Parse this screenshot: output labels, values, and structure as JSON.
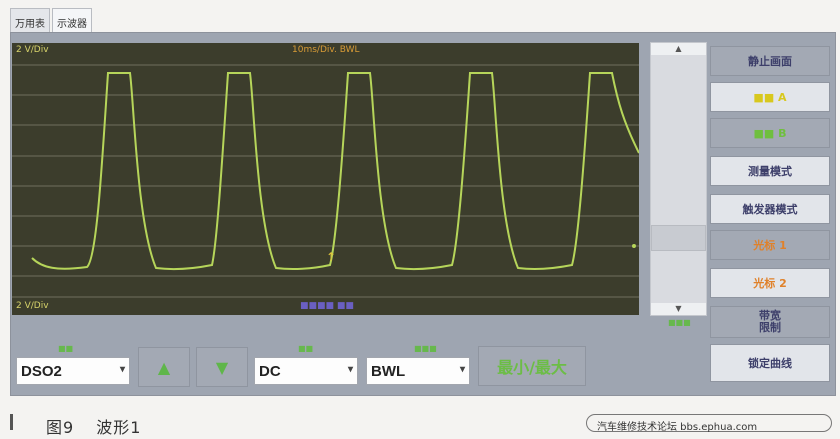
{
  "tabs": [
    {
      "label": "万用表",
      "active": false
    },
    {
      "label": "示波器",
      "active": true
    }
  ],
  "scope": {
    "top_left_label": "2 V/Div",
    "top_center_label": "10ms/Div. BWL",
    "bottom_left_label": "2 V/Div",
    "bottom_center_label": "■■■■ ■■"
  },
  "right_buttons": [
    {
      "label": "静止画面",
      "style": "normal"
    },
    {
      "label": "■■ A",
      "style": "yellow"
    },
    {
      "label": "■■ B",
      "style": "green"
    },
    {
      "label": "测量模式",
      "style": "light"
    },
    {
      "label": "触发器模式",
      "style": "light"
    },
    {
      "label": "光标 1",
      "style": "orange"
    },
    {
      "label": "光标 2",
      "style": "orange"
    },
    {
      "label": "带宽\n限制",
      "style": "normal"
    },
    {
      "label": "锁定曲线",
      "style": "light"
    }
  ],
  "controls": {
    "channel_label": "■■",
    "channel_value": "DSO2",
    "up_label": "▲",
    "down_label": "▼",
    "coupling_label": "■■",
    "coupling_value": "DC",
    "bw_label": "■■■",
    "bw_value": "BWL",
    "minmax_label": "最小/最大"
  },
  "scroll_small_label": "■■■",
  "caption": {
    "figure": "图9",
    "title": "波形1"
  },
  "watermark": "汽车维修技术论坛 bbs.ephua.com",
  "colors": {
    "scope_bg": "#3c3d2c",
    "trace": "#b6d55a",
    "grid": "#6f705e"
  }
}
